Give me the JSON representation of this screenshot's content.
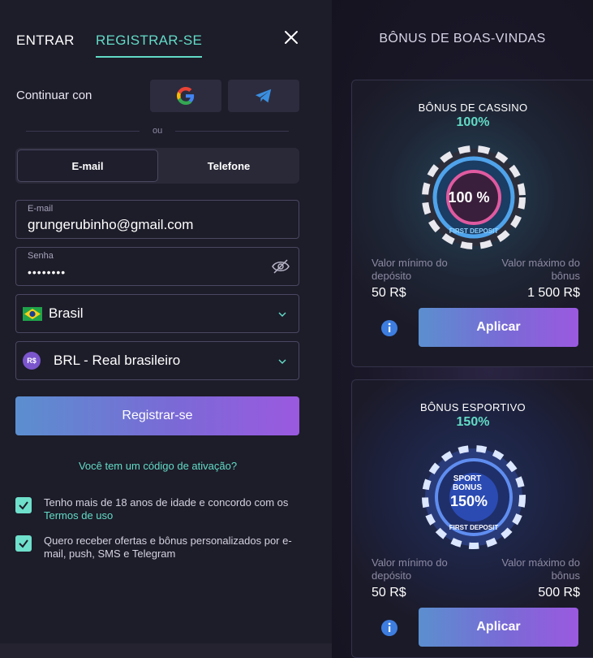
{
  "tabs": {
    "login": "ENTRAR",
    "register": "REGISTRAR-SE"
  },
  "social": {
    "label": "Continuar con",
    "divider": "ou"
  },
  "method": {
    "email": "E-mail",
    "phone": "Telefone"
  },
  "form": {
    "email_label": "E-mail",
    "email_value": "grungerubinho@gmail.com",
    "password_label": "Senha",
    "password_value": "••••••••",
    "country": "Brasil",
    "currency_badge": "R$",
    "currency": "BRL - Real brasileiro",
    "submit": "Registrar-se",
    "promo_link": "Você tem um código de ativação?",
    "age_text": "Tenho mais de 18 anos de idade e concordo com os",
    "terms_link": "Termos de uso",
    "offers_text": "Quero receber ofertas e bônus personalizados por e-mail, push, SMS e Telegram"
  },
  "welcome": {
    "title": "BÔNUS DE BOAS-VINDAS",
    "cards": [
      {
        "title": "BÔNUS DE CASSINO",
        "percent": "100%",
        "chip_text": "100 %",
        "chip_ring": "FIRST DEPOSIT",
        "min_label": "Valor mínimo do depósito",
        "min_value": "50 R$",
        "max_label": "Valor máximo do bônus",
        "max_value": "1 500 R$",
        "apply": "Aplicar"
      },
      {
        "title": "BÔNUS ESPORTIVO",
        "percent": "150%",
        "chip_line1": "SPORT",
        "chip_line2": "BONUS",
        "chip_text": "150%",
        "chip_ring": "FIRST DEPOSIT",
        "min_label": "Valor mínimo do depósito",
        "min_value": "50 R$",
        "max_label": "Valor máximo do bônus",
        "max_value": "500 R$",
        "apply": "Aplicar"
      }
    ]
  },
  "colors": {
    "accent": "#62dbc6",
    "button_start": "#5b8fcf",
    "button_end": "#9b59e0",
    "panel": "#1d1c29"
  }
}
